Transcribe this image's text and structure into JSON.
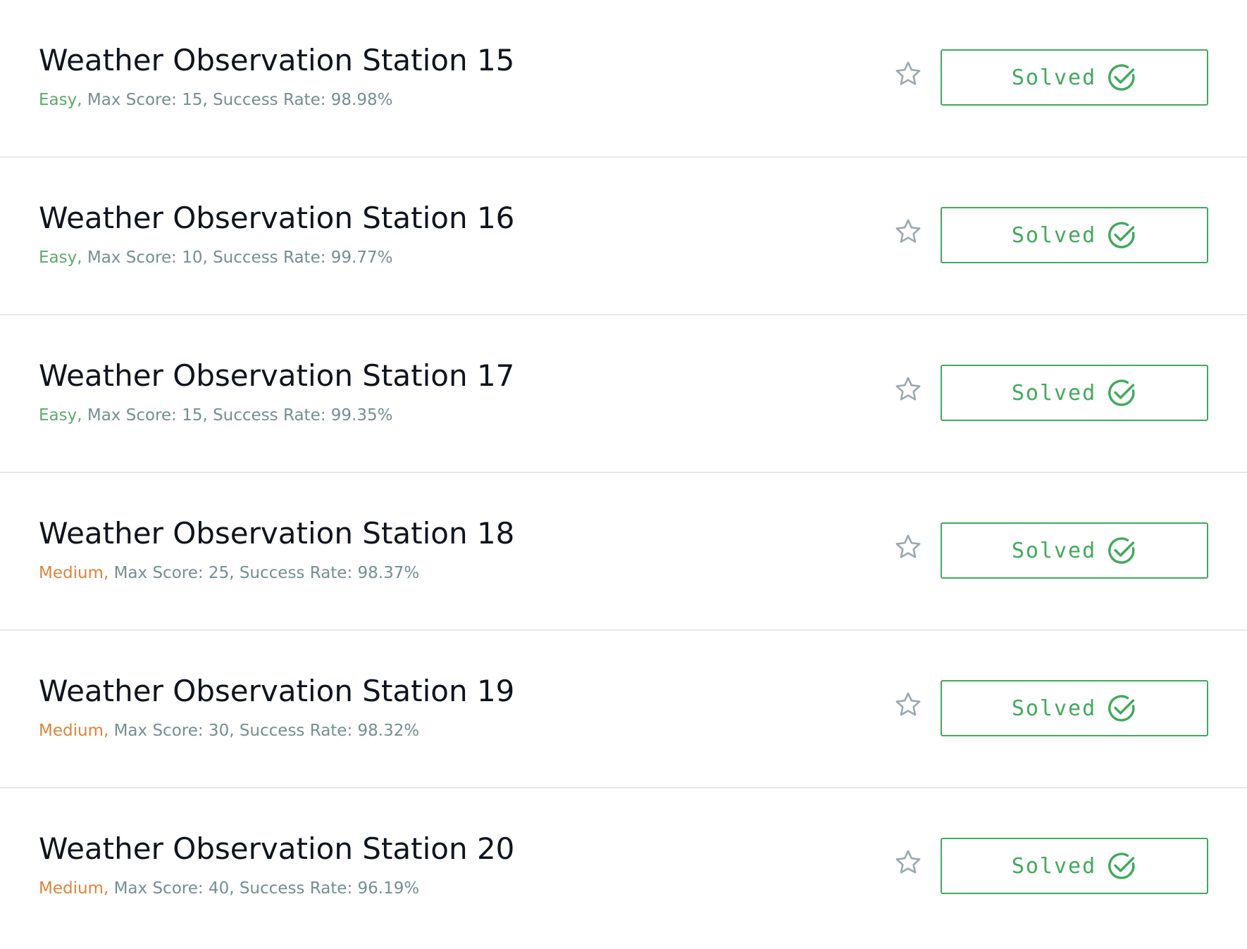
{
  "challenges": [
    {
      "title": "Weather Observation Station 15",
      "difficulty": "Easy",
      "difficulty_level": "easy",
      "rest": " Max Score: 15, Success Rate: 98.98%",
      "status": "Solved"
    },
    {
      "title": "Weather Observation Station 16",
      "difficulty": "Easy",
      "difficulty_level": "easy",
      "rest": " Max Score: 10, Success Rate: 99.77%",
      "status": "Solved"
    },
    {
      "title": "Weather Observation Station 17",
      "difficulty": "Easy",
      "difficulty_level": "easy",
      "rest": " Max Score: 15, Success Rate: 99.35%",
      "status": "Solved"
    },
    {
      "title": "Weather Observation Station 18",
      "difficulty": "Medium",
      "difficulty_level": "medium",
      "rest": " Max Score: 25, Success Rate: 98.37%",
      "status": "Solved"
    },
    {
      "title": "Weather Observation Station 19",
      "difficulty": "Medium",
      "difficulty_level": "medium",
      "rest": " Max Score: 30, Success Rate: 98.32%",
      "status": "Solved"
    },
    {
      "title": "Weather Observation Station 20",
      "difficulty": "Medium",
      "difficulty_level": "medium",
      "rest": " Max Score: 40, Success Rate: 96.19%",
      "status": "Solved"
    }
  ],
  "colors": {
    "easy": "#5bab6a",
    "medium": "#d9853b",
    "solved": "#3faa5b",
    "meta_text": "#738f93",
    "title_text": "#0e141e",
    "star_outline": "#9aa9b0"
  },
  "icons": {
    "bookmark": "star-outline-icon",
    "solved": "check-circle-icon"
  }
}
